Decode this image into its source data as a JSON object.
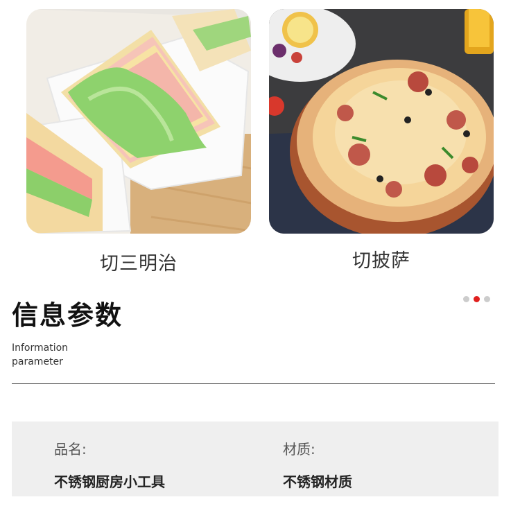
{
  "gallery": [
    {
      "caption": "切三明治",
      "image": "sandwich-photo"
    },
    {
      "caption": "切披萨",
      "image": "pizza-photo"
    }
  ],
  "section": {
    "title": "信息参数",
    "subtitle_line1": "Information",
    "subtitle_line2": "parameter"
  },
  "pager": {
    "count": 3,
    "active_index": 1
  },
  "specs": [
    {
      "key": "品名:",
      "value": "不锈钢厨房小工具"
    },
    {
      "key": "材质:",
      "value": "不锈钢材质"
    }
  ],
  "colors": {
    "accent": "#e0201e",
    "panel": "#efefef",
    "dot_inactive": "#cccccc"
  }
}
